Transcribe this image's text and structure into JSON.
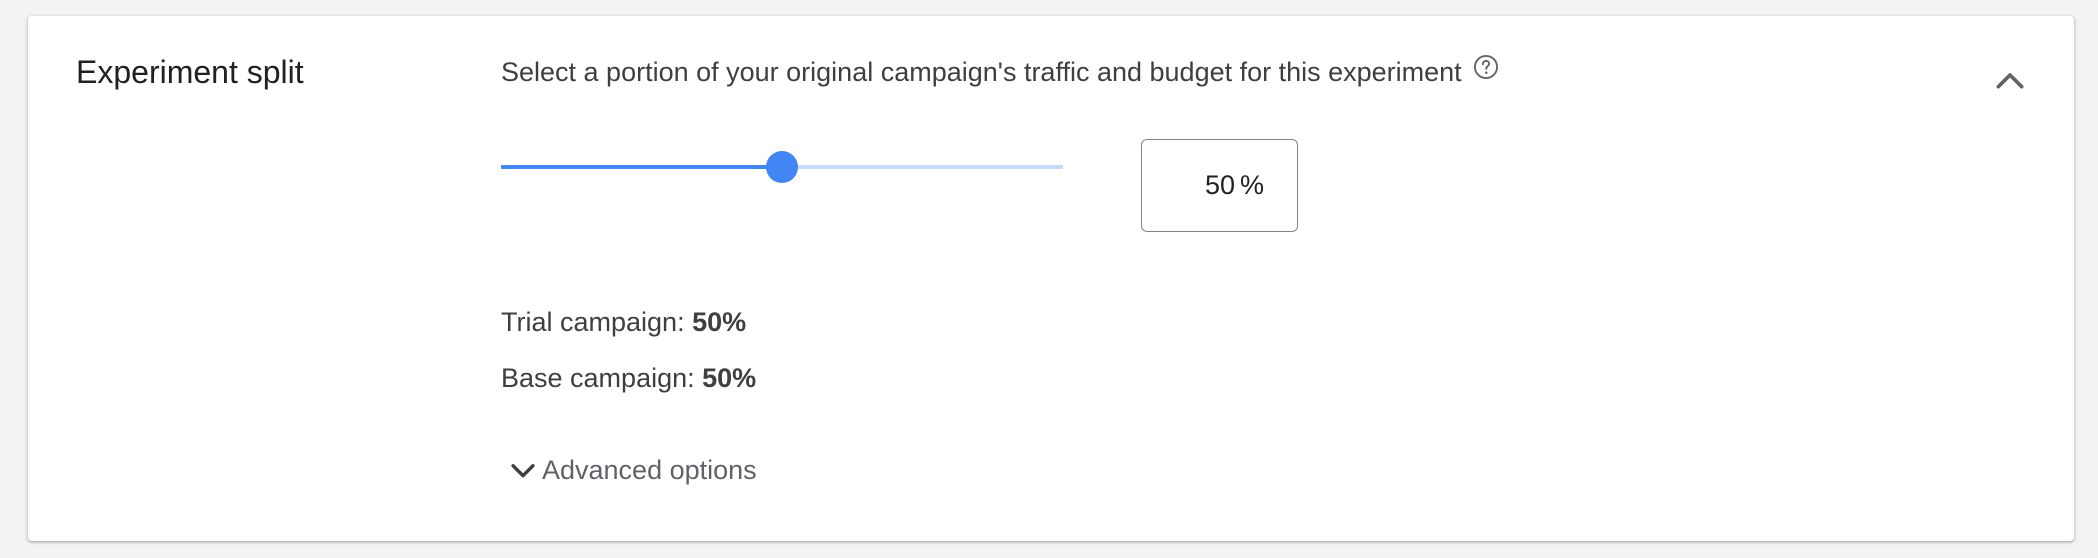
{
  "section": {
    "title": "Experiment split",
    "description": "Select a portion of your original campaign's traffic and budget for this experiment"
  },
  "slider": {
    "value_percent": 50,
    "accent_color": "#4285f4",
    "track_color": "#c6dafc"
  },
  "percent_input": {
    "value": "50",
    "suffix": "%"
  },
  "stats": {
    "trial_label": "Trial campaign:",
    "trial_value": "50%",
    "base_label": "Base campaign:",
    "base_value": "50%"
  },
  "advanced": {
    "label": "Advanced options"
  },
  "icons": {
    "help": "help-circle-icon",
    "collapse": "chevron-up-icon",
    "expand": "chevron-down-icon"
  }
}
